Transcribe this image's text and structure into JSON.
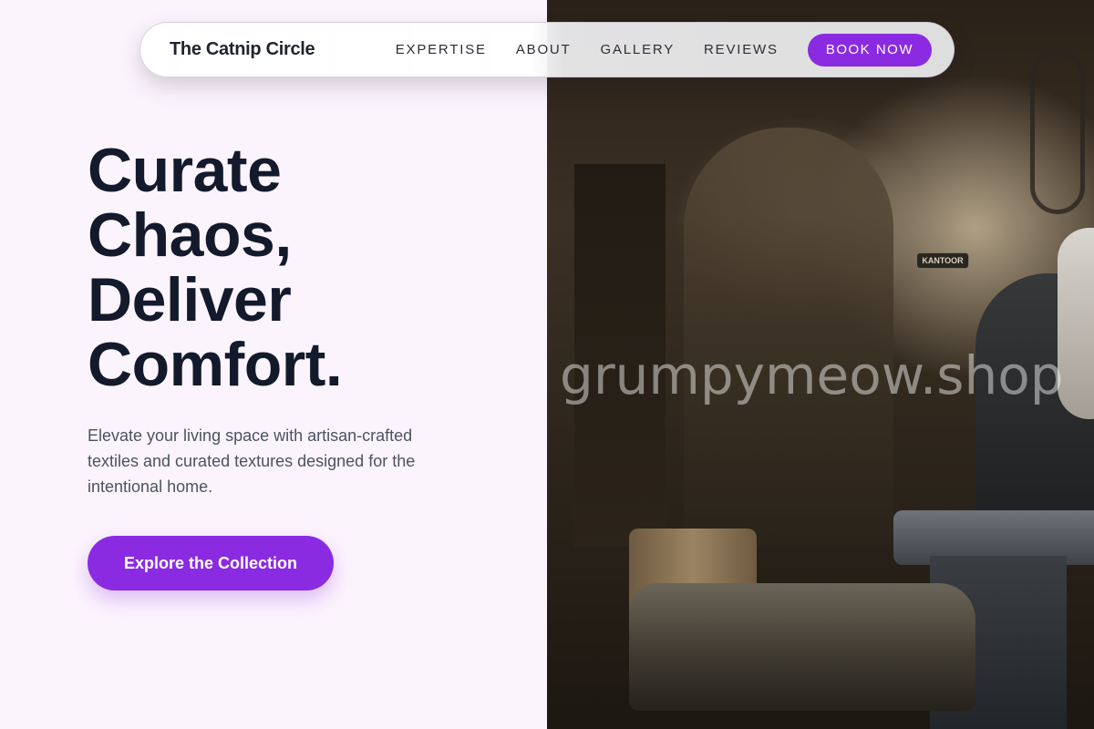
{
  "nav": {
    "brand": "The Catnip Circle",
    "links": [
      "EXPERTISE",
      "ABOUT",
      "GALLERY",
      "REVIEWS"
    ],
    "book_label": "BOOK NOW"
  },
  "hero": {
    "title_lines": [
      "Curate",
      "Chaos,",
      "Deliver",
      "Comfort."
    ],
    "subtitle": "Elevate your living space with artisan-crafted textiles and curated textures designed for the intentional home.",
    "cta_label": "Explore the Collection"
  },
  "photo": {
    "sign_text": "KANTOOR",
    "watermark": "grumpymeow.shop"
  },
  "colors": {
    "accent": "#8a2be2",
    "page_background": "#fcf4fd",
    "heading": "#121a2c",
    "body_text": "#4b5262"
  }
}
